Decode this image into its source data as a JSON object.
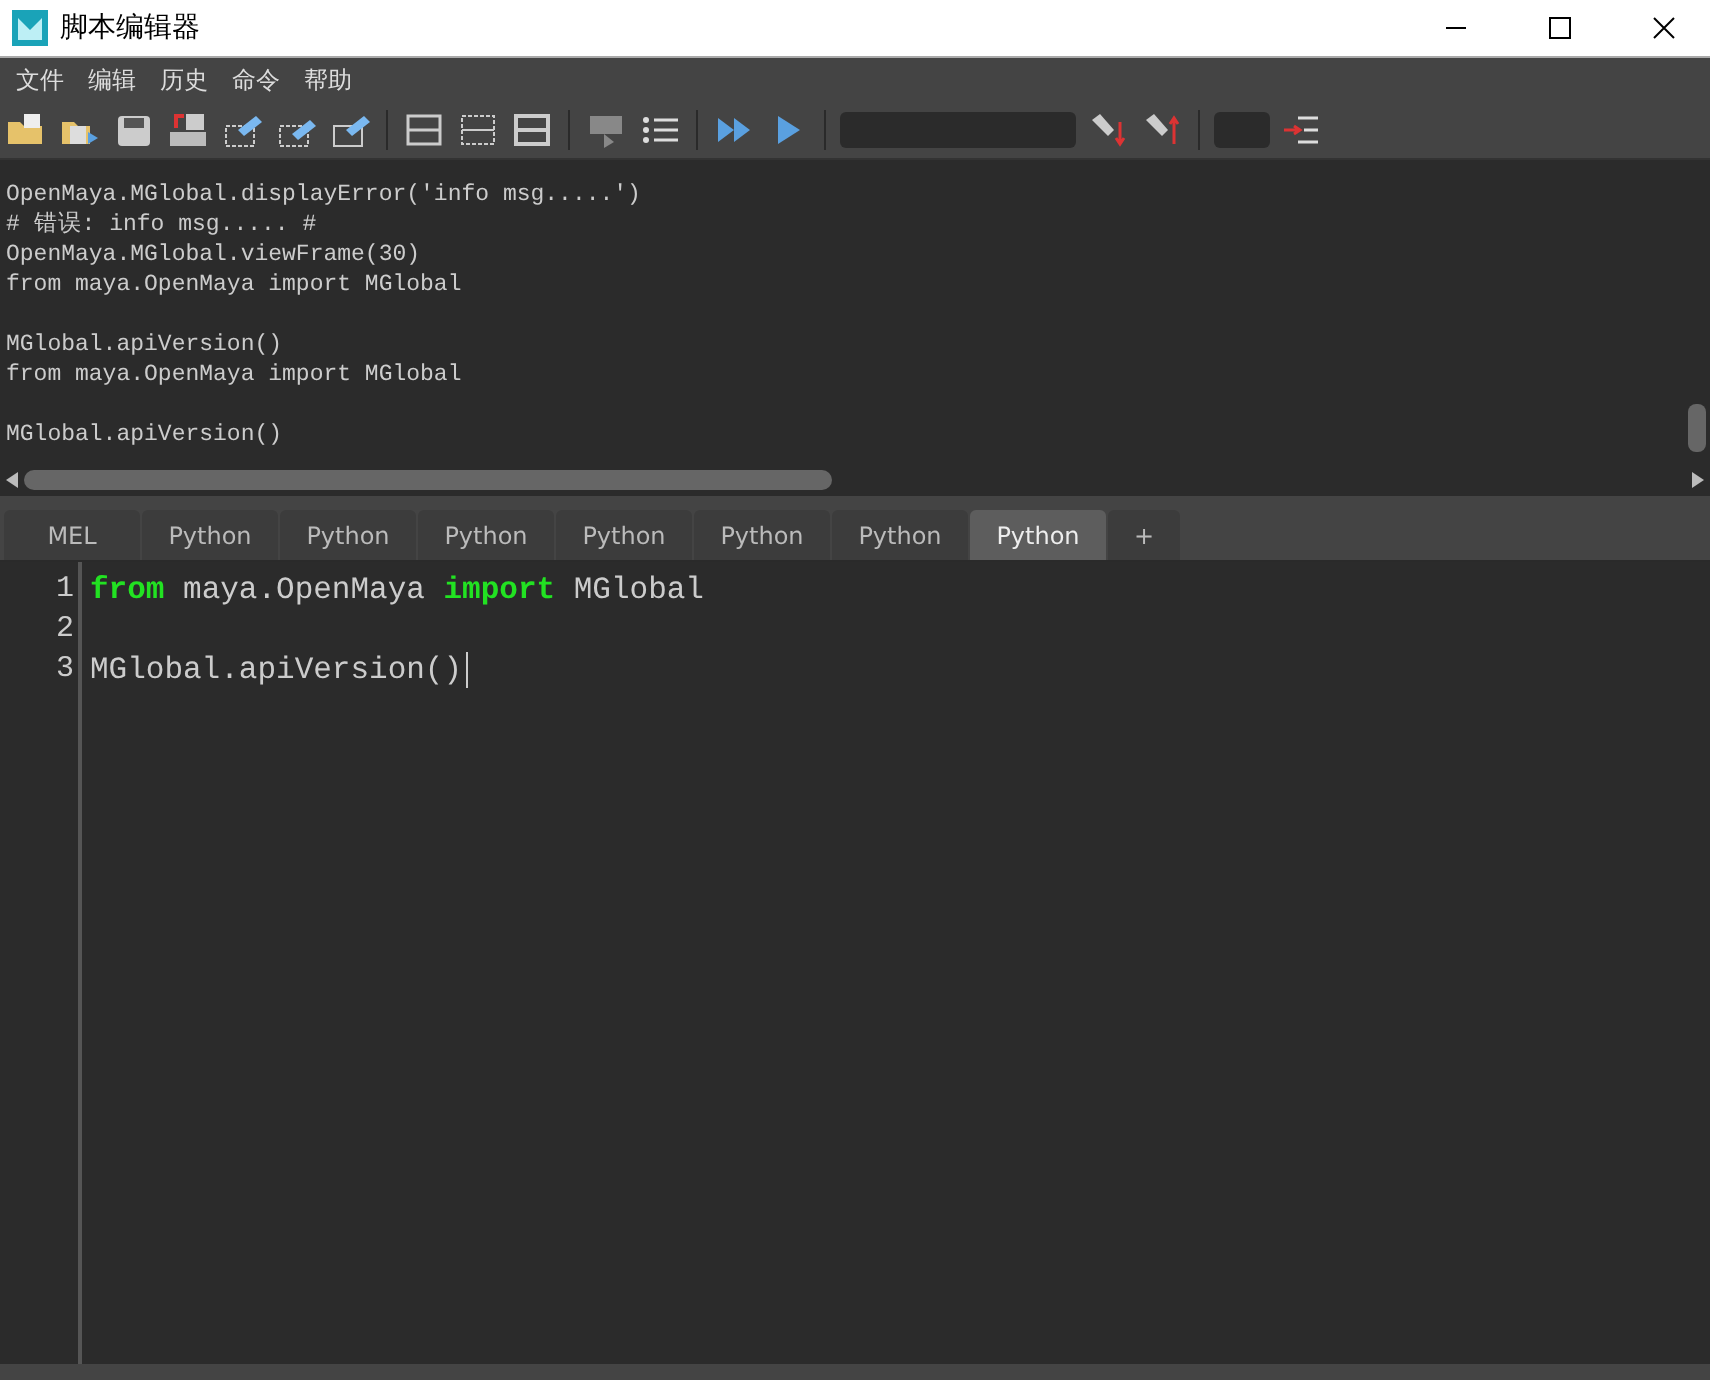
{
  "window": {
    "title": "脚本编辑器"
  },
  "menu": [
    "文件",
    "编辑",
    "历史",
    "命令",
    "帮助"
  ],
  "output": {
    "blocks": [
      [
        "OpenMaya.MGlobal.displayError('info msg.....')",
        "# 错误: info msg..... #",
        "OpenMaya.MGlobal.viewFrame(30)",
        "from maya.OpenMaya import MGlobal"
      ],
      [
        "MGlobal.apiVersion()",
        "from maya.OpenMaya import MGlobal"
      ],
      [
        "MGlobal.apiVersion()"
      ]
    ]
  },
  "tabs": [
    {
      "label": "MEL",
      "selected": false
    },
    {
      "label": "Python",
      "selected": false
    },
    {
      "label": "Python",
      "selected": false
    },
    {
      "label": "Python",
      "selected": false
    },
    {
      "label": "Python",
      "selected": false
    },
    {
      "label": "Python",
      "selected": false
    },
    {
      "label": "Python",
      "selected": false
    },
    {
      "label": "Python",
      "selected": true
    }
  ],
  "add_tab": "+",
  "editor": {
    "lines": [
      {
        "number": "1",
        "tokens": [
          {
            "kind": "keyword",
            "text": "from"
          },
          {
            "kind": "plain",
            "text": " maya.OpenMaya "
          },
          {
            "kind": "keyword",
            "text": "import"
          },
          {
            "kind": "plain",
            "text": " MGlobal"
          }
        ]
      },
      {
        "number": "2"
      },
      {
        "number": "3",
        "tokens": [
          {
            "kind": "plain",
            "text": "MGlobal.apiVersion()"
          }
        ],
        "cursor": true
      }
    ]
  }
}
